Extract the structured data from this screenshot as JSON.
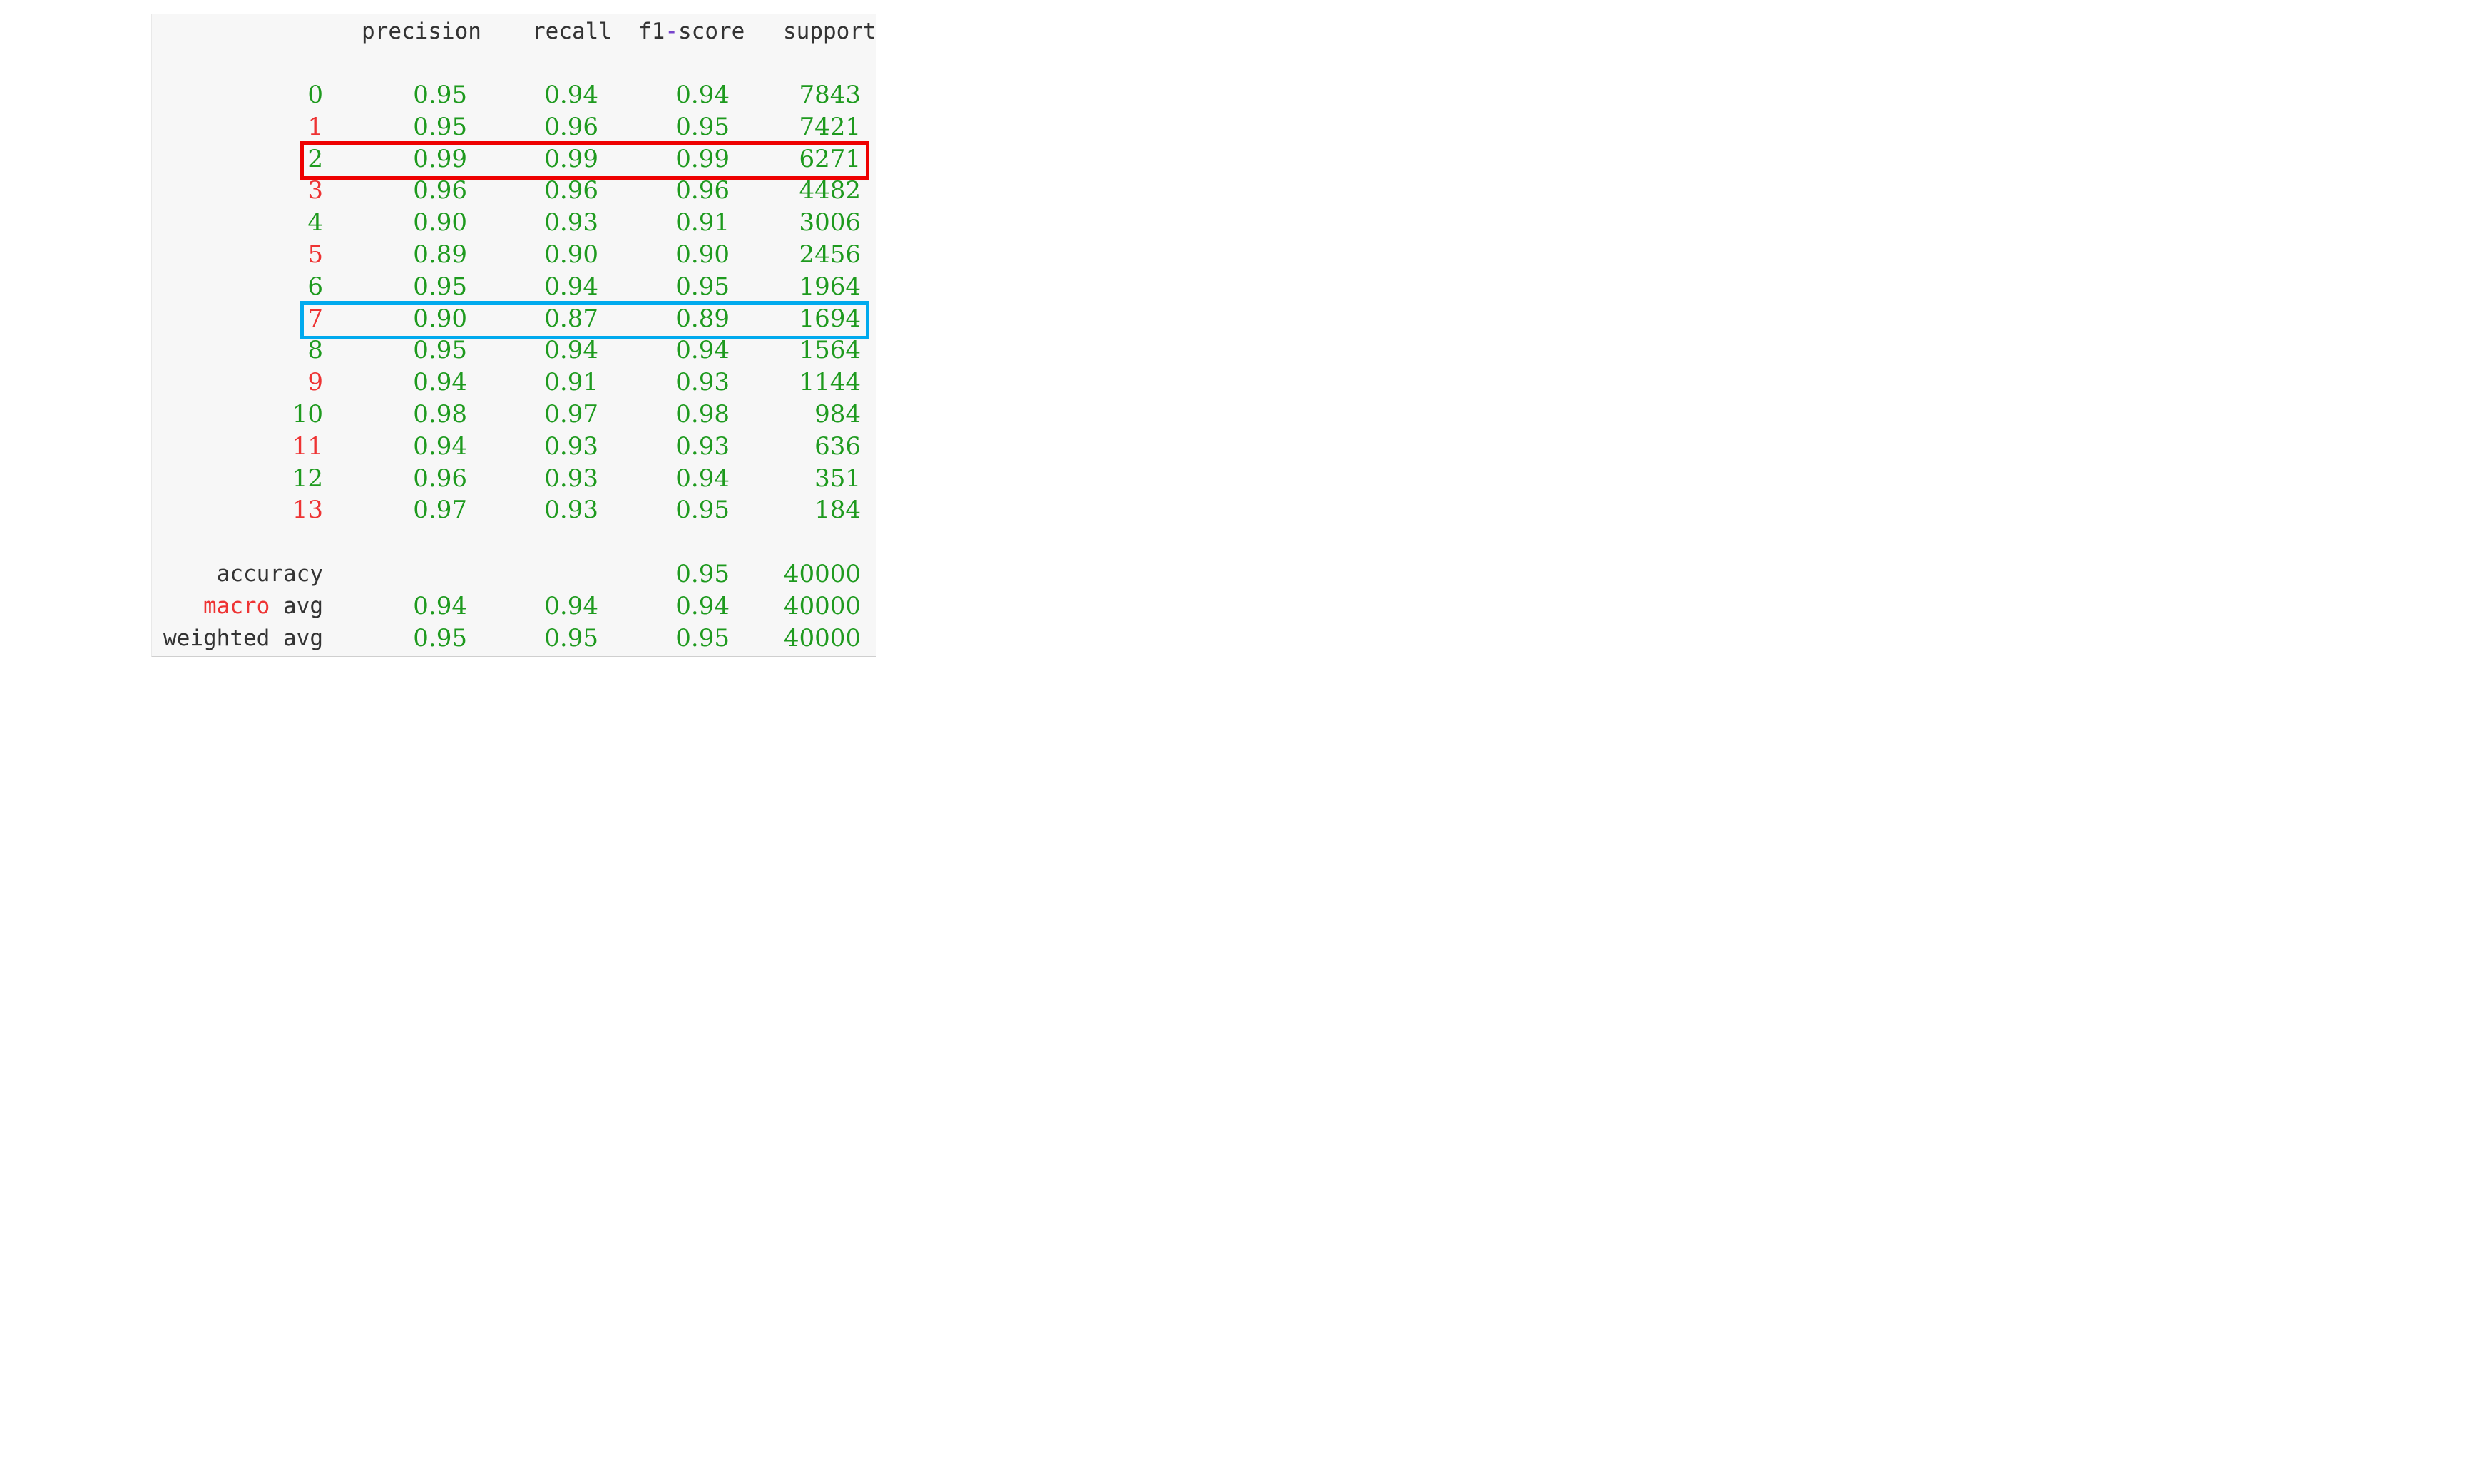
{
  "table": {
    "headers": {
      "precision": "precision",
      "recall": "recall",
      "f1_a": "f1",
      "f1_dash": "-",
      "f1_b": "score",
      "support": "support"
    },
    "rows": [
      {
        "label": "0",
        "label_color": "#1e9a1e",
        "precision": "0.95",
        "recall": "0.94",
        "f1": "0.94",
        "support": "7843"
      },
      {
        "label": "1",
        "label_color": "#ee3333",
        "precision": "0.95",
        "recall": "0.96",
        "f1": "0.95",
        "support": "7421"
      },
      {
        "label": "2",
        "label_color": "#1e9a1e",
        "precision": "0.99",
        "recall": "0.99",
        "f1": "0.99",
        "support": "6271"
      },
      {
        "label": "3",
        "label_color": "#ee3333",
        "precision": "0.96",
        "recall": "0.96",
        "f1": "0.96",
        "support": "4482"
      },
      {
        "label": "4",
        "label_color": "#1e9a1e",
        "precision": "0.90",
        "recall": "0.93",
        "f1": "0.91",
        "support": "3006"
      },
      {
        "label": "5",
        "label_color": "#ee3333",
        "precision": "0.89",
        "recall": "0.90",
        "f1": "0.90",
        "support": "2456"
      },
      {
        "label": "6",
        "label_color": "#1e9a1e",
        "precision": "0.95",
        "recall": "0.94",
        "f1": "0.95",
        "support": "1964"
      },
      {
        "label": "7",
        "label_color": "#ee3333",
        "precision": "0.90",
        "recall": "0.87",
        "f1": "0.89",
        "support": "1694"
      },
      {
        "label": "8",
        "label_color": "#1e9a1e",
        "precision": "0.95",
        "recall": "0.94",
        "f1": "0.94",
        "support": "1564"
      },
      {
        "label": "9",
        "label_color": "#ee3333",
        "precision": "0.94",
        "recall": "0.91",
        "f1": "0.93",
        "support": "1144"
      },
      {
        "label": "10",
        "label_color": "#1e9a1e",
        "precision": "0.98",
        "recall": "0.97",
        "f1": "0.98",
        "support": "984"
      },
      {
        "label": "11",
        "label_color": "#ee3333",
        "precision": "0.94",
        "recall": "0.93",
        "f1": "0.93",
        "support": "636"
      },
      {
        "label": "12",
        "label_color": "#1e9a1e",
        "precision": "0.96",
        "recall": "0.93",
        "f1": "0.94",
        "support": "351"
      },
      {
        "label": "13",
        "label_color": "#ee3333",
        "precision": "0.97",
        "recall": "0.93",
        "f1": "0.95",
        "support": "184"
      }
    ],
    "summary": {
      "accuracy": {
        "label": "accuracy",
        "f1": "0.95",
        "support": "40000"
      },
      "macro": {
        "label_a": "macro",
        "label_b": " avg",
        "precision": "0.94",
        "recall": "0.94",
        "f1": "0.94",
        "support": "40000"
      },
      "weighted": {
        "label": "weighted avg",
        "precision": "0.95",
        "recall": "0.95",
        "f1": "0.95",
        "support": "40000"
      }
    }
  },
  "highlights": [
    {
      "row_label": "2",
      "color": "#ee0000"
    },
    {
      "row_label": "7",
      "color": "#00aaee"
    }
  ]
}
